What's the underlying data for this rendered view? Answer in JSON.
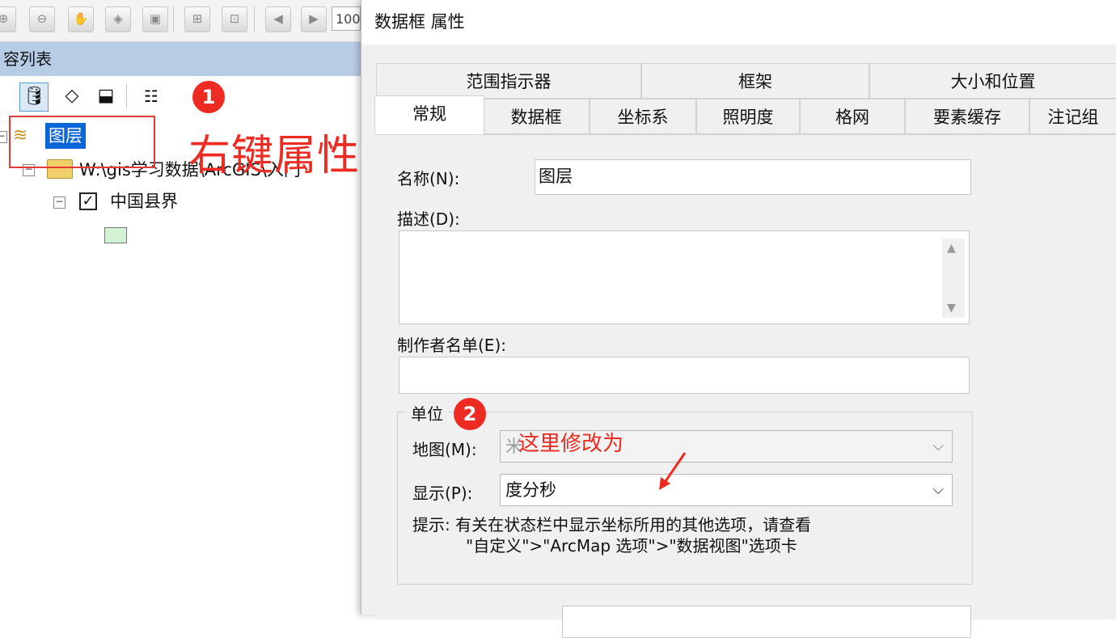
{
  "left_panel": {
    "toolbar": {
      "icons": [
        "zoom-in-fixed-icon",
        "zoom-out-fixed-icon",
        "pan-hand-icon",
        "full-extent-icon",
        "fixed-zoom-icon",
        "zoom-in-center-icon",
        "zoom-out-center-icon",
        "back-extent-icon",
        "forward-extent-icon"
      ],
      "zoom_value": "100"
    },
    "toc": {
      "title": "容列表",
      "layer_root": "图层",
      "folder_path": "W:\\gis学习数据\\ArcGIS\\入门",
      "layer_name": "中国县界"
    }
  },
  "annotations": {
    "badge1": "1",
    "text1": "右键属性",
    "badge2": "2",
    "text2": "这里修改为"
  },
  "dialog": {
    "title": "数据框 属性",
    "tabs_row1": [
      "范围指示器",
      "框架",
      "大小和位置"
    ],
    "tabs_row2": [
      "常规",
      "数据框",
      "坐标系",
      "照明度",
      "格网",
      "要素缓存",
      "注记组"
    ],
    "active_tab": "常规",
    "name_label": "名称(N):",
    "name_value": "图层",
    "desc_label": "描述(D):",
    "desc_value": "",
    "credits_label": "制作者名单(E):",
    "credits_value": "",
    "units_group": "单位",
    "map_label": "地图(M):",
    "map_value": "米",
    "display_label": "显示(P):",
    "display_value": "度分秒",
    "hint_line1": "提示: 有关在状态栏中显示坐标所用的其他选项，请查看",
    "hint_line2": "\"自定义\">\"ArcMap 选项\">\"数据视图\"选项卡"
  },
  "colors": {
    "accent_red": "#ee2b22",
    "selection_blue": "#0b66d8",
    "toc_header": "#b7cde6"
  }
}
